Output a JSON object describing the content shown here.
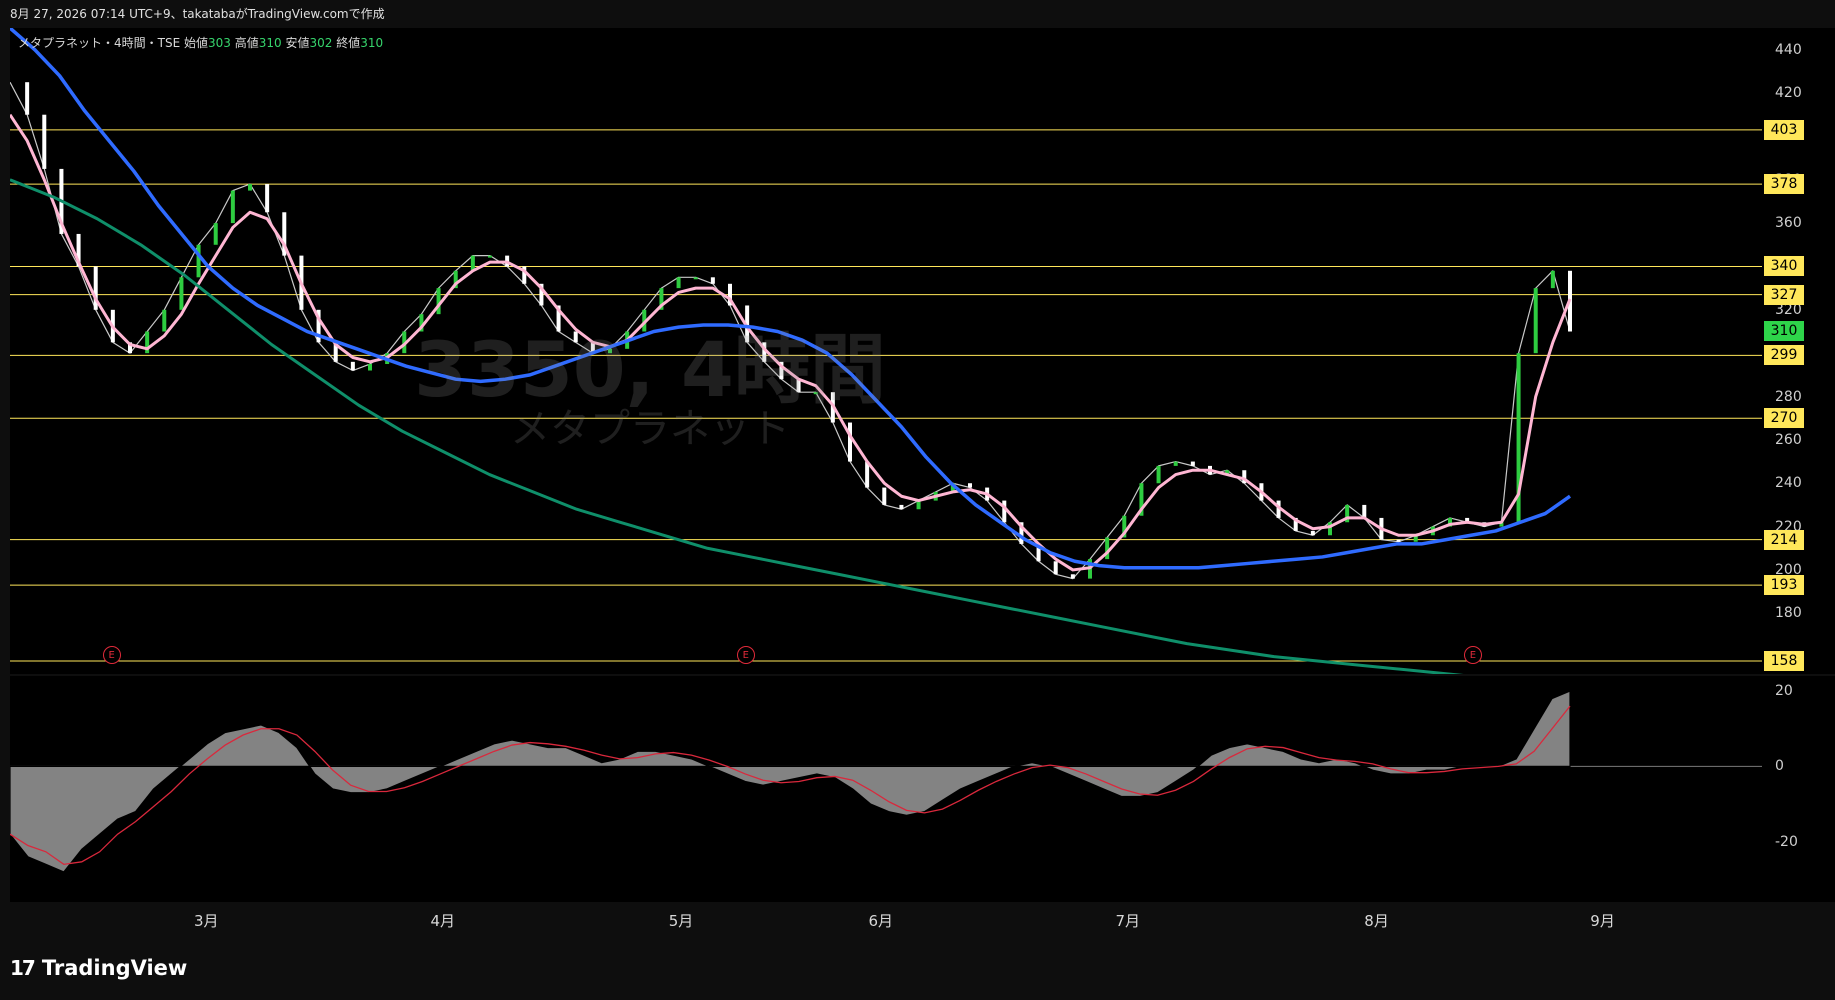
{
  "header": {
    "text": "8月 27, 2026 07:14 UTC+9、takatabaがTradingView.comで作成"
  },
  "legend": {
    "symbol": "メタプラネット・4時間・TSE",
    "open_label": "始値",
    "open": "303",
    "high_label": "高値",
    "high": "310",
    "low_label": "安値",
    "low": "302",
    "close_label": "終値",
    "close": "310"
  },
  "watermark": {
    "main": "3350, 4時間",
    "sub": "メタプラネット"
  },
  "brand": {
    "logo": "17",
    "name": "TradingView"
  },
  "colors": {
    "up": "#2ecc40",
    "down": "#ffffff",
    "hline": "#ffe75a",
    "ma_blue": "#2f6bff",
    "ma_pink": "#ffb6d3",
    "ma_green": "#0f8f6a",
    "ma_lightgreen": "#8fcf8a",
    "bb": "#3f86d6",
    "badge_current": "#2ed44a"
  },
  "chart_data": {
    "type": "line",
    "main": {
      "y_axis_ticks": [
        440,
        420,
        380,
        360,
        320,
        280,
        260,
        240,
        220,
        200,
        180
      ],
      "ylim": [
        152,
        450
      ],
      "price_levels": [
        403,
        378,
        340,
        327,
        299,
        270,
        214,
        193,
        158
      ],
      "current_price": 310,
      "x_axis_labels": [
        "3月",
        "4月",
        "5月",
        "6月",
        "7月",
        "8月",
        "9月"
      ],
      "earnings_marker": "E",
      "earnings_count": 3,
      "series": [
        {
          "role": "close",
          "values": [
            425,
            410,
            385,
            355,
            340,
            320,
            305,
            300,
            310,
            320,
            335,
            350,
            360,
            375,
            378,
            365,
            345,
            320,
            305,
            296,
            292,
            295,
            300,
            310,
            318,
            330,
            338,
            345,
            345,
            340,
            332,
            322,
            310,
            305,
            300,
            302,
            310,
            320,
            330,
            335,
            335,
            332,
            322,
            305,
            296,
            288,
            282,
            282,
            268,
            250,
            238,
            230,
            228,
            232,
            236,
            240,
            238,
            232,
            222,
            212,
            204,
            198,
            196,
            205,
            215,
            225,
            240,
            248,
            250,
            248,
            244,
            246,
            240,
            232,
            224,
            218,
            216,
            222,
            230,
            224,
            214,
            213,
            216,
            220,
            224,
            222,
            220,
            222,
            300,
            330,
            338,
            310
          ]
        },
        {
          "role": "ma-short-pink",
          "values": [
            410,
            398,
            380,
            360,
            342,
            325,
            312,
            304,
            302,
            308,
            318,
            332,
            345,
            358,
            365,
            362,
            350,
            332,
            316,
            304,
            298,
            296,
            298,
            304,
            312,
            322,
            332,
            338,
            342,
            342,
            338,
            330,
            320,
            311,
            305,
            303,
            306,
            314,
            322,
            328,
            330,
            330,
            325,
            312,
            302,
            294,
            288,
            285,
            276,
            262,
            250,
            240,
            234,
            232,
            234,
            236,
            237,
            235,
            229,
            220,
            212,
            205,
            200,
            201,
            208,
            217,
            228,
            238,
            244,
            246,
            246,
            244,
            242,
            236,
            229,
            223,
            219,
            220,
            224,
            224,
            219,
            216,
            216,
            218,
            221,
            222,
            221,
            222,
            235,
            280,
            305,
            325
          ]
        },
        {
          "role": "ma-mid-blue",
          "values": [
            450,
            440,
            428,
            412,
            398,
            384,
            368,
            354,
            340,
            330,
            322,
            316,
            310,
            306,
            302,
            298,
            294,
            291,
            288,
            287,
            288,
            290,
            294,
            298,
            302,
            306,
            310,
            312,
            313,
            313,
            312,
            310,
            306,
            300,
            290,
            278,
            266,
            252,
            240,
            230,
            222,
            214,
            208,
            204,
            202,
            201,
            201,
            201,
            201,
            202,
            203,
            204,
            205,
            206,
            208,
            210,
            212,
            212,
            214,
            216,
            218,
            222,
            226,
            234
          ]
        },
        {
          "role": "ma-long-green",
          "values": [
            380,
            372,
            362,
            350,
            336,
            320,
            304,
            290,
            276,
            264,
            254,
            244,
            236,
            228,
            222,
            216,
            210,
            206,
            202,
            198,
            194,
            190,
            186,
            182,
            178,
            174,
            170,
            166,
            163,
            160,
            158,
            156,
            154,
            152,
            150
          ]
        }
      ]
    },
    "oscillator": {
      "y_axis_ticks": [
        20,
        0,
        -20
      ],
      "ylim": [
        -36,
        24
      ],
      "histogram": [
        -18,
        -24,
        -26,
        -28,
        -22,
        -18,
        -14,
        -12,
        -6,
        -2,
        2,
        6,
        9,
        10,
        11,
        9,
        5,
        -2,
        -6,
        -7,
        -7,
        -6,
        -4,
        -2,
        0,
        2,
        4,
        6,
        7,
        6,
        5,
        5,
        3,
        1,
        2,
        4,
        4,
        3,
        2,
        0,
        -2,
        -4,
        -5,
        -4,
        -3,
        -2,
        -3,
        -6,
        -10,
        -12,
        -13,
        -12,
        -9,
        -6,
        -4,
        -2,
        0,
        1,
        0,
        -2,
        -4,
        -6,
        -8,
        -8,
        -7,
        -4,
        -1,
        3,
        5,
        6,
        5,
        4,
        2,
        1,
        2,
        1,
        -1,
        -2,
        -2,
        -1,
        -1,
        0,
        0,
        0,
        2,
        10,
        18,
        20
      ]
    }
  }
}
